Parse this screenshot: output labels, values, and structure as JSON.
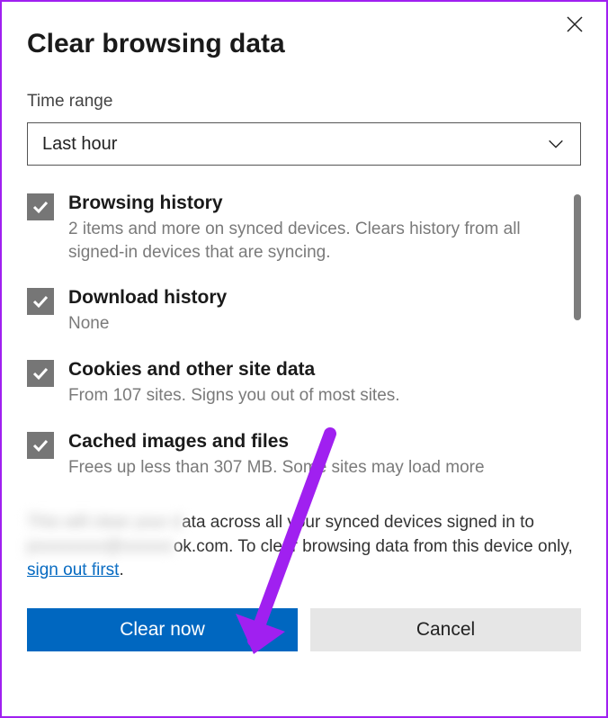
{
  "dialog": {
    "title": "Clear browsing data",
    "close_icon": "close"
  },
  "time_range": {
    "label": "Time range",
    "selected": "Last hour"
  },
  "options": [
    {
      "checked": true,
      "title": "Browsing history",
      "desc": "2 items and more on synced devices. Clears history from all signed-in devices that are syncing."
    },
    {
      "checked": true,
      "title": "Download history",
      "desc": "None"
    },
    {
      "checked": true,
      "title": "Cookies and other site data",
      "desc": "From 107 sites. Signs you out of most sites."
    },
    {
      "checked": true,
      "title": "Cached images and files",
      "desc": "Frees up less than 307 MB. Some sites may load more"
    }
  ],
  "info": {
    "part1": "This will clear your data across all your synced devices signed in to ",
    "blur1": "xxxxxxxxxxxxxxxxxxx",
    "part2": "ok.com. To clear browsing data from this device only, ",
    "link": "sign out first",
    "part3": "."
  },
  "buttons": {
    "primary": "Clear now",
    "secondary": "Cancel"
  }
}
